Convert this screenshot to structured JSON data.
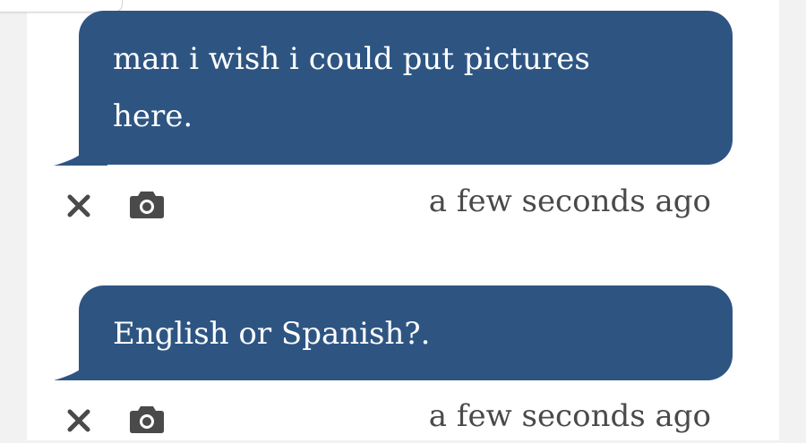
{
  "conversation": {
    "messages": [
      {
        "text": "man i wish i could put pictures here.",
        "timestamp": "a few seconds ago",
        "delete_icon": "close-icon",
        "photo_icon": "camera-icon"
      },
      {
        "text": "English or Spanish?.",
        "timestamp": "a few seconds ago",
        "delete_icon": "close-icon",
        "photo_icon": "camera-icon"
      }
    ]
  },
  "colors": {
    "bubble": "#2e5582",
    "bubble_text": "#ffffff",
    "icon": "#4a4a4a",
    "page_background": "#f2f2f2",
    "panel_background": "#ffffff"
  }
}
